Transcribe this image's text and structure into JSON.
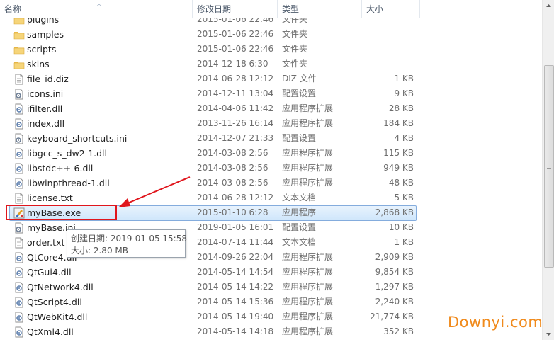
{
  "columns": {
    "name": "名称",
    "date": "修改日期",
    "type": "类型",
    "size": "大小"
  },
  "rows": [
    {
      "name": "plugins",
      "date": "2015-01-06 22:46",
      "type": "文件夹",
      "size": "",
      "icon": "folder"
    },
    {
      "name": "samples",
      "date": "2015-01-06 22:46",
      "type": "文件夹",
      "size": "",
      "icon": "folder"
    },
    {
      "name": "scripts",
      "date": "2015-01-06 22:46",
      "type": "文件夹",
      "size": "",
      "icon": "folder"
    },
    {
      "name": "skins",
      "date": "2014-12-18 6:30",
      "type": "文件夹",
      "size": "",
      "icon": "folder"
    },
    {
      "name": "file_id.diz",
      "date": "2014-06-28 12:12",
      "type": "DIZ 文件",
      "size": "1 KB",
      "icon": "doc"
    },
    {
      "name": "icons.ini",
      "date": "2014-12-11 13:04",
      "type": "配置设置",
      "size": "9 KB",
      "icon": "ini"
    },
    {
      "name": "ifilter.dll",
      "date": "2014-04-06 11:42",
      "type": "应用程序扩展",
      "size": "28 KB",
      "icon": "dll"
    },
    {
      "name": "index.dll",
      "date": "2013-11-26 16:14",
      "type": "应用程序扩展",
      "size": "184 KB",
      "icon": "dll"
    },
    {
      "name": "keyboard_shortcuts.ini",
      "date": "2014-12-07 21:33",
      "type": "配置设置",
      "size": "4 KB",
      "icon": "ini"
    },
    {
      "name": "libgcc_s_dw2-1.dll",
      "date": "2014-03-08 2:56",
      "type": "应用程序扩展",
      "size": "115 KB",
      "icon": "dll"
    },
    {
      "name": "libstdc++-6.dll",
      "date": "2014-03-08 2:56",
      "type": "应用程序扩展",
      "size": "949 KB",
      "icon": "dll"
    },
    {
      "name": "libwinpthread-1.dll",
      "date": "2014-03-08 2:56",
      "type": "应用程序扩展",
      "size": "48 KB",
      "icon": "dll"
    },
    {
      "name": "license.txt",
      "date": "2014-06-28 12:12",
      "type": "文本文档",
      "size": "5 KB",
      "icon": "doc"
    },
    {
      "name": "myBase.exe",
      "date": "2015-01-10 6:28",
      "type": "应用程序",
      "size": "2,868 KB",
      "icon": "exe",
      "selected": true
    },
    {
      "name": "myBase.ini",
      "date": "2019-01-05 16:01",
      "type": "配置设置",
      "size": "10 KB",
      "icon": "ini"
    },
    {
      "name": "order.txt",
      "date": "2014-07-14 11:44",
      "type": "文本文档",
      "size": "1 KB",
      "icon": "doc"
    },
    {
      "name": "QtCore4.dll",
      "date": "2014-09-26 22:04",
      "type": "应用程序扩展",
      "size": "2,909 KB",
      "icon": "dll"
    },
    {
      "name": "QtGui4.dll",
      "date": "2014-05-14 14:54",
      "type": "应用程序扩展",
      "size": "9,854 KB",
      "icon": "dll"
    },
    {
      "name": "QtNetwork4.dll",
      "date": "2014-05-14 14:22",
      "type": "应用程序扩展",
      "size": "1,297 KB",
      "icon": "dll"
    },
    {
      "name": "QtScript4.dll",
      "date": "2014-05-14 15:36",
      "type": "应用程序扩展",
      "size": "2,240 KB",
      "icon": "dll"
    },
    {
      "name": "QtWebKit4.dll",
      "date": "2014-05-14 19:40",
      "type": "应用程序扩展",
      "size": "21,774 KB",
      "icon": "dll"
    },
    {
      "name": "QtXml4.dll",
      "date": "2014-05-14 14:18",
      "type": "应用程序扩展",
      "size": "352 KB",
      "icon": "dll"
    }
  ],
  "tooltip": {
    "line1": "创建日期: 2019-01-05 15:58",
    "line2": "大小: 2.80 MB"
  },
  "watermark": "Downyi.com",
  "colors": {
    "annotation": "#e0161d",
    "selection": "#cfe6fb",
    "watermark": "#f08a1c",
    "folder": "#f2c75c"
  }
}
